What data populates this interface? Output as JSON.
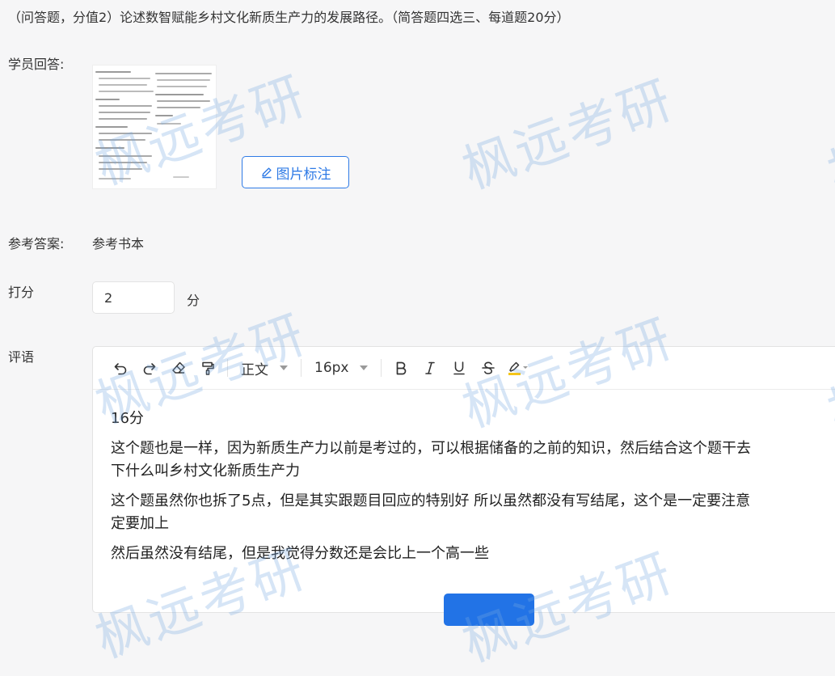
{
  "question": {
    "text": "（问答题，分值2）论述数智赋能乡村文化新质生产力的发展路径。（简答题四选三、每道题20分）"
  },
  "answer": {
    "label": "学员回答:",
    "annotate_button": "图片标注"
  },
  "reference": {
    "label": "参考答案:",
    "value": "参考书本"
  },
  "score": {
    "label": "打分",
    "value": "2",
    "unit": "分"
  },
  "comment": {
    "label": "评语",
    "toolbar": {
      "paragraph_style": "正文",
      "font_size": "16px"
    },
    "paragraphs": [
      "16分",
      "这个题也是一样，因为新质生产力以前是考过的，可以根据储备的之前的知识，然后结合这个题干去",
      "下什么叫乡村文化新质生产力",
      "这个题虽然你也拆了5点，但是其实跟题目回应的特别好 所以虽然都没有写结尾，这个是一定要注意",
      "定要加上",
      "然后虽然没有结尾，但是我觉得分数还是会比上一个高一些"
    ]
  },
  "watermark": {
    "text": "枫远考研"
  }
}
